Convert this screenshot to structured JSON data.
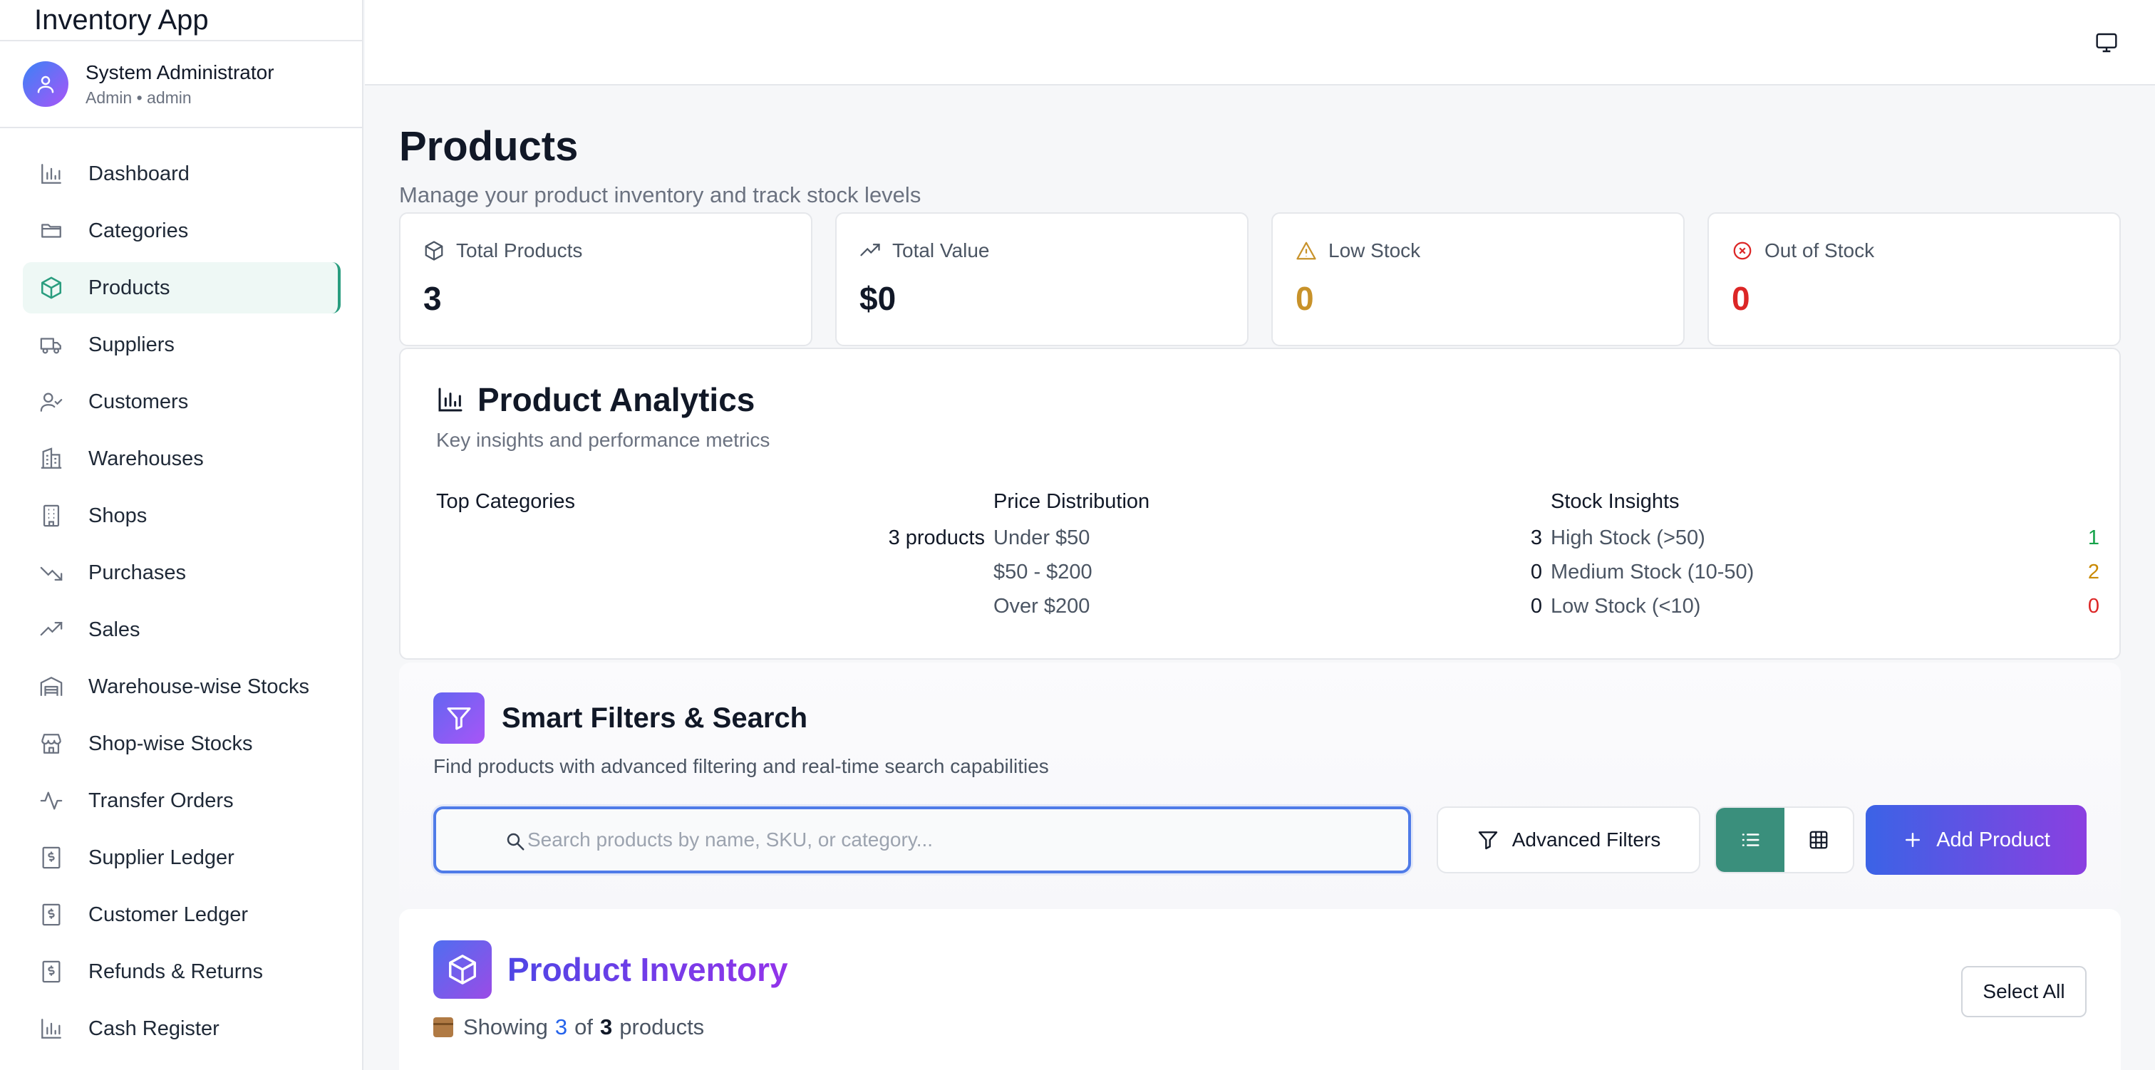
{
  "app": {
    "title": "Inventory App"
  },
  "user": {
    "name": "System Administrator",
    "role": "Admin • admin"
  },
  "sidebar": {
    "items": [
      {
        "label": "Dashboard",
        "icon": "bar-chart-icon"
      },
      {
        "label": "Categories",
        "icon": "folder-icon"
      },
      {
        "label": "Products",
        "icon": "package-icon",
        "active": true
      },
      {
        "label": "Suppliers",
        "icon": "truck-icon"
      },
      {
        "label": "Customers",
        "icon": "user-check-icon"
      },
      {
        "label": "Warehouses",
        "icon": "building-icon"
      },
      {
        "label": "Shops",
        "icon": "building-2-icon"
      },
      {
        "label": "Purchases",
        "icon": "trending-down-icon"
      },
      {
        "label": "Sales",
        "icon": "trending-up-icon"
      },
      {
        "label": "Warehouse-wise Stocks",
        "icon": "warehouse-icon"
      },
      {
        "label": "Shop-wise Stocks",
        "icon": "store-icon"
      },
      {
        "label": "Transfer Orders",
        "icon": "activity-icon"
      },
      {
        "label": "Supplier Ledger",
        "icon": "dollar-doc-icon"
      },
      {
        "label": "Customer Ledger",
        "icon": "dollar-doc-icon"
      },
      {
        "label": "Refunds & Returns",
        "icon": "dollar-doc-icon"
      },
      {
        "label": "Cash Register",
        "icon": "bar-chart-icon"
      }
    ]
  },
  "page": {
    "title": "Products",
    "subtitle": "Manage your product inventory and track stock levels"
  },
  "stats": [
    {
      "label": "Total Products",
      "value": "3",
      "color": "#111827",
      "icon": "package-icon"
    },
    {
      "label": "Total Value",
      "value": "$0",
      "color": "#111827",
      "icon": "trending-up-icon"
    },
    {
      "label": "Low Stock",
      "value": "0",
      "color": "#c8922a",
      "icon": "alert-triangle-icon"
    },
    {
      "label": "Out of Stock",
      "value": "0",
      "color": "#dc2626",
      "icon": "x-circle-icon"
    }
  ],
  "analytics": {
    "title": "Product Analytics",
    "subtitle": "Key insights and performance metrics",
    "top_categories": {
      "title": "Top Categories",
      "rows": [
        {
          "label": "",
          "value": "3 products"
        }
      ]
    },
    "price_distribution": {
      "title": "Price Distribution",
      "rows": [
        {
          "label": "Under $50",
          "value": "3"
        },
        {
          "label": "$50 - $200",
          "value": "0"
        },
        {
          "label": "Over $200",
          "value": "0"
        }
      ]
    },
    "stock_insights": {
      "title": "Stock Insights",
      "rows": [
        {
          "label": "High Stock (>50)",
          "value": "1",
          "color": "#16a34a"
        },
        {
          "label": "Medium Stock (10-50)",
          "value": "2",
          "color": "#ca8a04"
        },
        {
          "label": "Low Stock (<10)",
          "value": "0",
          "color": "#dc2626"
        }
      ]
    }
  },
  "filters": {
    "title": "Smart Filters & Search",
    "subtitle": "Find products with advanced filtering and real-time search capabilities",
    "search_placeholder": "Search products by name, SKU, or category...",
    "advanced_label": "Advanced Filters",
    "add_label": "Add Product",
    "view_mode": "list"
  },
  "inventory": {
    "title": "Product Inventory",
    "showing_prefix": "Showing",
    "shown": "3",
    "of_word": "of",
    "total": "3",
    "suffix": "products",
    "select_all": "Select All"
  }
}
